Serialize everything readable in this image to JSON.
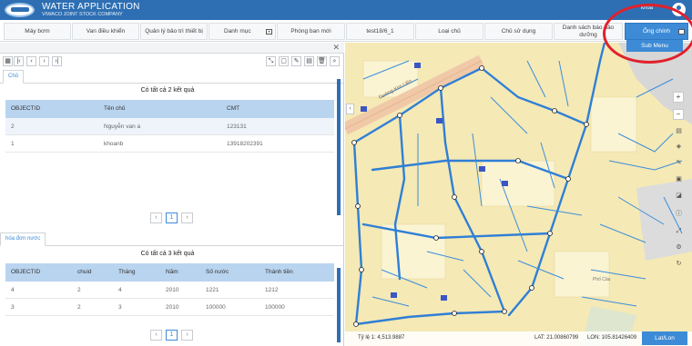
{
  "app": {
    "title": "WATER APPLICATION",
    "subtitle": "VIWACO JOINT STOCK COMPANY",
    "user": "khoa"
  },
  "menu": [
    {
      "label": "Máy bơm",
      "name": "menu-may-bom"
    },
    {
      "label": "Van điều khiển",
      "name": "menu-van-dieu-khien"
    },
    {
      "label": "Quản lý bảo trì thiết bị",
      "name": "menu-quan-ly-bao-tri"
    },
    {
      "label": "Danh mục",
      "name": "menu-danh-muc"
    },
    {
      "label": "Phòng ban mới",
      "name": "menu-phong-ban-moi"
    },
    {
      "label": "test18/6_1",
      "name": "menu-test"
    },
    {
      "label": "Loại chủ",
      "name": "menu-loai-chu"
    },
    {
      "label": "Chủ sử dụng",
      "name": "menu-chu-su-dung"
    },
    {
      "label": "Danh sách báo bảo dưỡng",
      "name": "menu-danh-sach-bao"
    },
    {
      "label": "Ống chính",
      "name": "menu-ong-chinh"
    }
  ],
  "submenu_label": "Sub Menu",
  "panel1": {
    "tab": "Chủ",
    "count": "Có tất cả 2 kết quả",
    "columns": [
      "OBJECTID",
      "Tên chủ",
      "CMT"
    ],
    "rows": [
      [
        "2",
        "Nguyễn van a",
        "123131"
      ],
      [
        "1",
        "khoanb",
        "13918202391"
      ]
    ],
    "page": "1"
  },
  "panel2": {
    "tab": "hóa đơn nước",
    "count": "Có tất cả 3 kết quả",
    "columns": [
      "OBJECTID",
      "chuid",
      "Tháng",
      "Năm",
      "Số nước",
      "Thành tiền"
    ],
    "rows": [
      [
        "4",
        "2",
        "4",
        "2010",
        "1221",
        "1212"
      ],
      [
        "3",
        "2",
        "3",
        "2010",
        "100000",
        "100000"
      ]
    ],
    "page": "1"
  },
  "map": {
    "scale": "Tỷ lệ 1: 4,513.9887",
    "lat": "LAT: 21.00860799",
    "lon": "LON: 105.81426409",
    "latlon_button": "Lat/Lon",
    "street1": "Đường Kim Liên",
    "street2": "Phố Cầu"
  },
  "colors": {
    "header": "#2e6fb3",
    "accent": "#3d8bd6",
    "map_bg": "#f5e9b5",
    "pipe": "#2f7fd6",
    "highlight": "#e0212c"
  }
}
